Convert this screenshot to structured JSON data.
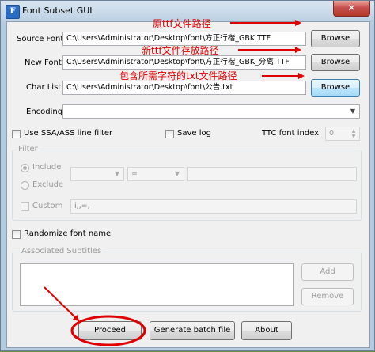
{
  "window": {
    "title": "Font Subset GUI",
    "icon_letter": "F",
    "close_glyph": "✕"
  },
  "files": {
    "source_font_label": "Source Font",
    "source_font_value": "C:\\Users\\Administrator\\Desktop\\font\\方正行楷_GBK.TTF",
    "new_font_label": "New Font",
    "new_font_value": "C:\\Users\\Administrator\\Desktop\\font\\方正行楷_GBK_分离.TTF",
    "char_list_label": "Char List",
    "char_list_value": "C:\\Users\\Administrator\\Desktop\\font\\公告.txt",
    "browse_label": "Browse"
  },
  "encoding": {
    "label": "Encoding",
    "value": ""
  },
  "options": {
    "ssa_filter_label": "Use SSA/ASS line filter",
    "save_log_label": "Save log",
    "ttc_label": "TTC font index",
    "ttc_value": "0"
  },
  "filter": {
    "title": "Filter",
    "include_label": "Include",
    "exclude_label": "Exclude",
    "custom_label": "Custom",
    "operator_value": "=",
    "custom_value": "i,,=,"
  },
  "randomize_label": "Randomize font name",
  "subtitles": {
    "title": "Associated Subtitles",
    "add_label": "Add",
    "remove_label": "Remove"
  },
  "actions": {
    "proceed_label": "Proceed",
    "batch_label": "Generate batch file",
    "about_label": "About"
  },
  "annotations": {
    "source_note": "原ttf文件路径",
    "new_note": "新ttf文件存放路径",
    "charlist_note": "包含所需字符的txt文件路径"
  },
  "colors": {
    "annotation": "#e00000",
    "accent": "#3c7fb1"
  }
}
